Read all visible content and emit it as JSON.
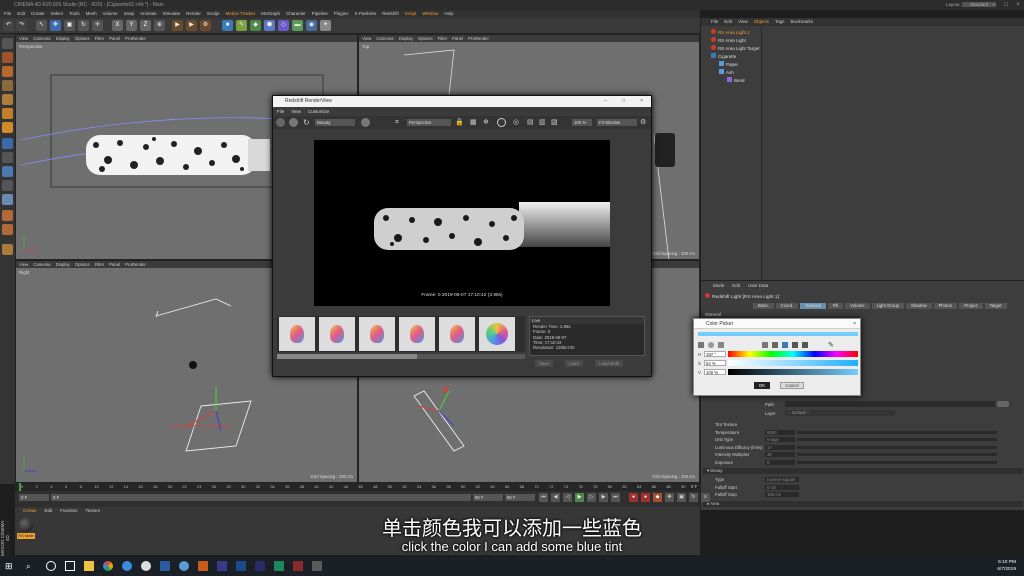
{
  "app": {
    "title": "CINEMA 4D R20.026 Studio (RC - R20) - [Cigarette02.c4d *] - Main",
    "layout_label": "Layout:",
    "layout_value": "Standard"
  },
  "menubar": [
    "File",
    "Edit",
    "Create",
    "Select",
    "Tools",
    "Mesh",
    "Volume",
    "Snap",
    "Animate",
    "Simulate",
    "Render",
    "Sculpt",
    "Motion Tracker",
    "MoGraph",
    "Character",
    "Pipeline",
    "Plugins",
    "X-Particles",
    "Redshift",
    "Script",
    "Window",
    "Help"
  ],
  "menubar_highlight": [
    "Motion Tracker",
    "Script",
    "Window"
  ],
  "toolbar": {
    "x": "X",
    "y": "Y",
    "z": "Z"
  },
  "viewport_menu": [
    "View",
    "Cameras",
    "Display",
    "Options",
    "Filter",
    "Panel",
    "ProRender"
  ],
  "viewports": {
    "perspective": {
      "label": "Perspective"
    },
    "top": {
      "label": "Top",
      "grid": "Grid Spacing : 100 cm"
    },
    "right": {
      "label": "Right",
      "grid": "Grid Spacing : 100 cm"
    },
    "front": {
      "grid": "Grid Spacing : 100 cm"
    }
  },
  "objects_panel": {
    "menu": [
      "File",
      "Edit",
      "View",
      "Objects",
      "Tags",
      "Bookmarks"
    ],
    "active_menu": "Objects",
    "items": [
      "RS Area Light.1",
      "RS Area Light",
      "RS Area Light Target",
      "Cigarette",
      "Paper",
      "Ash",
      "Bend"
    ]
  },
  "attributes": {
    "menu": [
      "Mode",
      "Edit",
      "User Data"
    ],
    "object_title": "Redshift Light [RS Area Light.1]",
    "tabs": [
      "Basic",
      "Coord.",
      "General",
      "Fill",
      "Volume",
      "Light Group",
      "Shadow",
      "Photon",
      "Project",
      "Target"
    ],
    "active_tab": "General",
    "section": "General",
    "path_label": "Path",
    "layer_label": "Layer",
    "layer_value": "-- Default --",
    "rows": [
      {
        "label": "Tint Texture"
      },
      {
        "label": "Temperature",
        "value": "6500"
      },
      {
        "label": "Unit Type",
        "value": "Image"
      },
      {
        "label": "Luminous Efficacy (lm/w)",
        "value": "17"
      },
      {
        "label": "Intensity Multiplier",
        "value": "30"
      },
      {
        "label": "Exposure",
        "value": "0"
      }
    ],
    "decay_header": "Decay",
    "decay_rows": [
      {
        "label": "Type",
        "value": "Inverse-square"
      },
      {
        "label": "Falloff Start",
        "value": "0 cm"
      },
      {
        "label": "Falloff Stop",
        "value": "100 cm"
      }
    ],
    "area_header": "Area",
    "apply_label": "Apply"
  },
  "renderview": {
    "title": "Redshift RenderView",
    "menu": [
      "File",
      "View",
      "Customize"
    ],
    "mode": "Beauty",
    "camera": "Perspective",
    "zoom": "100 %",
    "fit": "Fit Window",
    "frame_caption": "Frame: 0   2019-06-07   17:10:42   (3.98s)",
    "log_header": "Live",
    "log_lines": [
      "Render Time: 3.98s",
      "Frame: 0",
      "Date: 2019-06-07",
      "Time: 17:10:42",
      "Resolution: 1280x720"
    ],
    "buttons": [
      "Save",
      "Load",
      "Load Multi"
    ]
  },
  "color_picker": {
    "title": "Color Picker",
    "h_label": "H",
    "h_value": "197 °",
    "s_label": "S",
    "s_value": "54 %",
    "v_label": "V",
    "v_value": "100 %",
    "ok": "OK",
    "cancel": "Cancel",
    "picked_color": "#75cdfd"
  },
  "timeline": {
    "ticks": [
      "0",
      "2",
      "4",
      "6",
      "8",
      "10",
      "12",
      "14",
      "16",
      "18",
      "20",
      "22",
      "24",
      "26",
      "28",
      "30",
      "32",
      "34",
      "36",
      "38",
      "40",
      "42",
      "44",
      "46",
      "48",
      "50",
      "52",
      "54",
      "56",
      "58",
      "60",
      "62",
      "64",
      "66",
      "68",
      "70",
      "72",
      "74",
      "76",
      "78",
      "80",
      "82",
      "84",
      "86",
      "88",
      "90"
    ],
    "start": "0 F",
    "current": "0 F",
    "end": "90 F",
    "end2": "90 F",
    "frame_label": "0 F"
  },
  "material_panel": {
    "menu": [
      "Create",
      "Edit",
      "Function",
      "Texture"
    ],
    "material_name": "RS Mate"
  },
  "side_label": "MAXON CINEMA 4D",
  "taskbar": {
    "time": "5:10 PM",
    "date": "6/7/2019"
  },
  "subtitles": {
    "cn": "单击颜色我可以添加一些蓝色",
    "en": "click the color I can add some blue tint"
  },
  "colors": {
    "orange": "#f0a030",
    "active_tab": "#6a8fb0",
    "red_icon": "#d03a2a"
  }
}
